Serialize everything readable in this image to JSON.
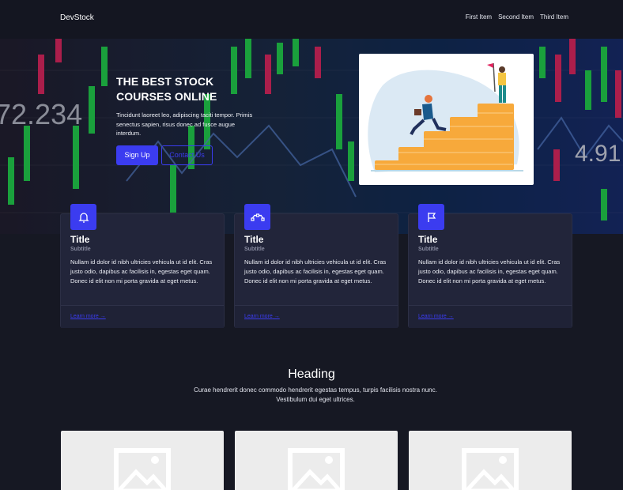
{
  "brand": "DevStock",
  "nav": {
    "items": [
      "First Item",
      "Second Item",
      "Third Item"
    ]
  },
  "hero": {
    "title": "THE BEST STOCK COURSES ONLINE",
    "text": "Tincidunt laoreet leo, adipiscing taciti tempor. Primis senectus sapien, risus donec ad fusce augue interdum.",
    "primary_button": "Sign Up",
    "secondary_button": "Contact Us",
    "background_numbers": [
      "72.234",
      "4.91"
    ]
  },
  "cards": [
    {
      "icon": "bell-icon",
      "title": "Title",
      "subtitle": "Subtitle",
      "body": "Nullam id dolor id nibh ultricies vehicula ut id elit. Cras justo odio, dapibus ac facilisis in, egestas eget quam. Donec id elit non mi porta gravida at eget metus.",
      "link": "Learn more"
    },
    {
      "icon": "bezier-icon",
      "title": "Title",
      "subtitle": "Subtitle",
      "body": "Nullam id dolor id nibh ultricies vehicula ut id elit. Cras justo odio, dapibus ac facilisis in, egestas eget quam. Donec id elit non mi porta gravida at eget metus.",
      "link": "Learn more"
    },
    {
      "icon": "flag-icon",
      "title": "Title",
      "subtitle": "Subtitle",
      "body": "Nullam id dolor id nibh ultricies vehicula ut id elit. Cras justo odio, dapibus ac facilisis in, egestas eget quam. Donec id elit non mi porta gravida at eget metus.",
      "link": "Learn more"
    }
  ],
  "section": {
    "heading": "Heading",
    "text": "Curae hendrerit donec commodo hendrerit egestas tempus, turpis facilisis nostra nunc. Vestibulum dui eget ultrices."
  },
  "colors": {
    "accent": "#3b3cf0",
    "background": "#161823",
    "card": "#22253a"
  }
}
